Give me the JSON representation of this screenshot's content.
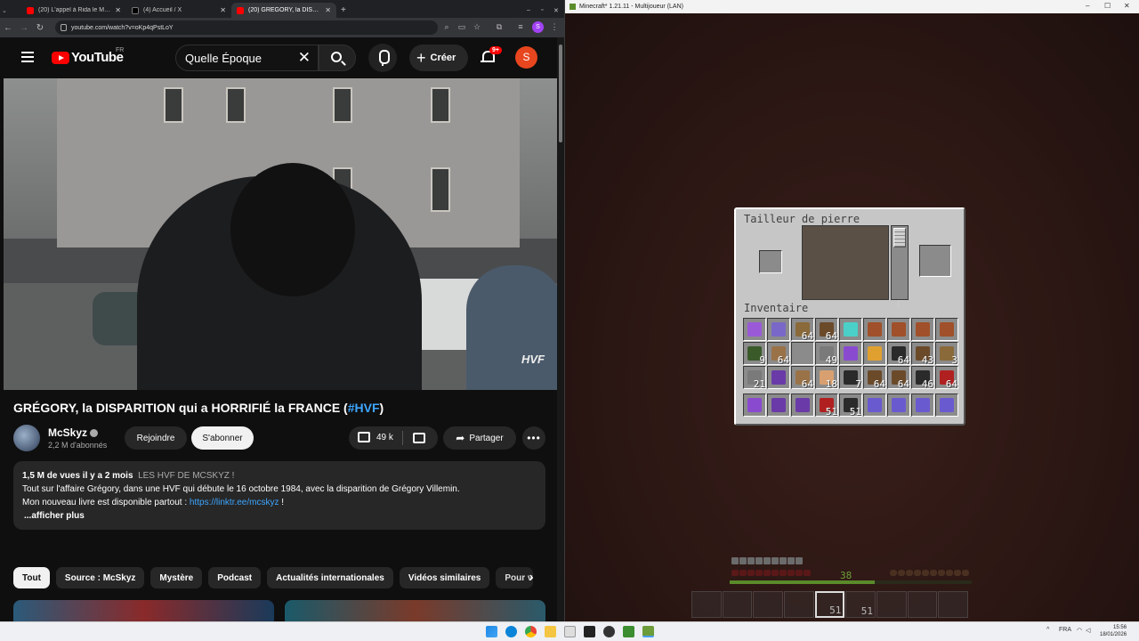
{
  "browser": {
    "tabs": [
      {
        "title": "(20) L'appel à Rida le Marseillais",
        "active": false
      },
      {
        "title": "(4) Accueil / X",
        "active": false
      },
      {
        "title": "(20) GRÉGORY, la DISPARITION",
        "active": true
      }
    ],
    "url": "youtube.com/watch?v=oKp4qPstLoY",
    "profile_initial": "S"
  },
  "youtube": {
    "logo_text": "YouTube",
    "country": "FR",
    "search_value": "Quelle Époque",
    "create_label": "Créer",
    "notif_badge": "9+",
    "avatar_initial": "S",
    "video_watermark": "HVF",
    "video_title": "GRÉGORY, la DISPARITION qui a HORRIFIÉ la FRANCE (",
    "video_title_tag": "#HVF",
    "video_title_end": ")",
    "channel_name": "McSkyz",
    "subscribers": "2,2 M d'abonnés",
    "join_label": "Rejoindre",
    "subscribe_label": "S'abonner",
    "likes": "49 k",
    "share_label": "Partager",
    "description": {
      "meta": "1,5 M de vues  il y a 2 mois",
      "hashtag": "LES HVF DE MCSKYZ !",
      "line1": "Tout sur l'affaire Grégory, dans une HVF qui débute le 16 octobre 1984, avec la disparition de Grégory Villemin.",
      "line2_prefix": "Mon nouveau livre est disponible partout : ",
      "line2_link": "https://linktr.ee/mcskyz",
      "line2_suffix": " !",
      "more": "...afficher plus"
    },
    "chips": [
      "Tout",
      "Source : McSkyz",
      "Mystère",
      "Podcast",
      "Actualités internationales",
      "Vidéos similaires",
      "Pour v"
    ]
  },
  "minecraft": {
    "window_title": "Minecraft* 1.21.11 - Multijoueur (LAN)",
    "gui_title": "Tailleur de pierre",
    "inventory_label": "Inventaire",
    "xp_level": "38",
    "inventory": [
      [
        {
          "item": "amethyst",
          "c": ""
        },
        {
          "item": "amethyst-legs",
          "c": ""
        },
        {
          "item": "stick",
          "c": "64"
        },
        {
          "item": "log",
          "c": "64"
        },
        {
          "item": "diamond-pick",
          "c": ""
        },
        {
          "item": "leather",
          "c": ""
        },
        {
          "item": "leather",
          "c": ""
        },
        {
          "item": "leather",
          "c": ""
        },
        {
          "item": "leather",
          "c": ""
        }
      ],
      [
        {
          "item": "sapling",
          "c": "9"
        },
        {
          "item": "planks",
          "c": "64"
        },
        {
          "item": "empty",
          "c": ""
        },
        {
          "item": "stone",
          "c": "49"
        },
        {
          "item": "sword",
          "c": ""
        },
        {
          "item": "torch",
          "c": ""
        },
        {
          "item": "coal",
          "c": "64"
        },
        {
          "item": "log",
          "c": "43"
        },
        {
          "item": "stick",
          "c": "3"
        }
      ],
      [
        {
          "item": "stone",
          "c": "21"
        },
        {
          "item": "pickaxe",
          "c": ""
        },
        {
          "item": "planks",
          "c": "64"
        },
        {
          "item": "chicken",
          "c": "18"
        },
        {
          "item": "coal",
          "c": "7"
        },
        {
          "item": "log",
          "c": "64"
        },
        {
          "item": "log",
          "c": "64"
        },
        {
          "item": "coal",
          "c": "46"
        },
        {
          "item": "redstone",
          "c": "64"
        }
      ],
      [
        {
          "item": "sword",
          "c": ""
        },
        {
          "item": "pickaxe",
          "c": ""
        },
        {
          "item": "pickaxe",
          "c": ""
        },
        {
          "item": "redstone",
          "c": "51"
        },
        {
          "item": "coal",
          "c": "51"
        },
        {
          "item": "bowl",
          "c": ""
        },
        {
          "item": "bowl",
          "c": ""
        },
        {
          "item": "bowl",
          "c": ""
        },
        {
          "item": "bowl",
          "c": ""
        }
      ]
    ],
    "hotbar_counts": [
      "",
      "",
      "",
      "",
      "51",
      "51",
      "",
      "",
      ""
    ]
  },
  "taskbar": {
    "lang": "FRA",
    "time": "15:56",
    "date": "18/01/2026"
  },
  "colors": {
    "yt_red": "#ff0000",
    "link_blue": "#3ea6ff"
  }
}
